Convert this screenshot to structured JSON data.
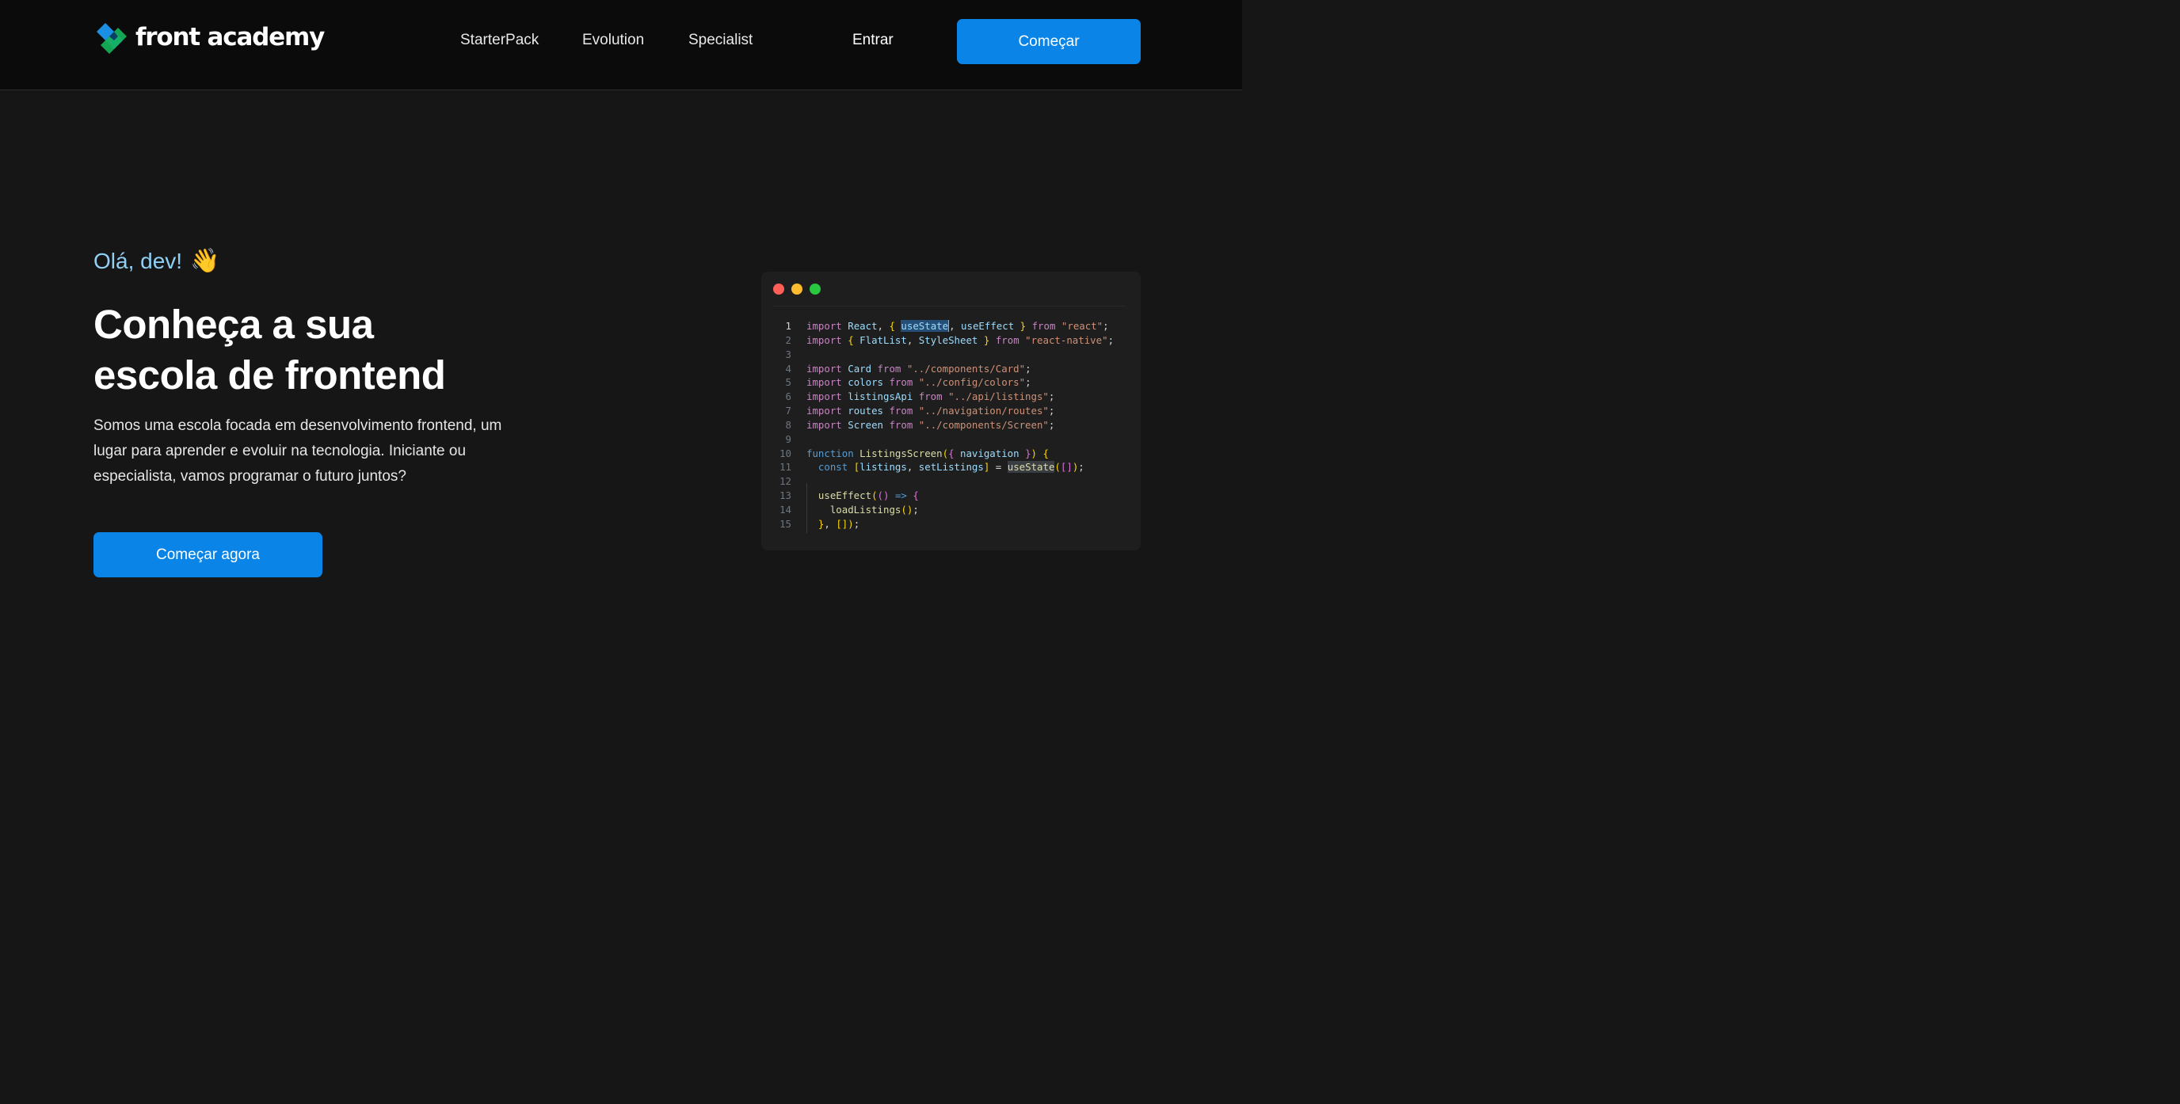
{
  "header": {
    "brand": "front academy",
    "nav": [
      "StarterPack",
      "Evolution",
      "Specialist"
    ],
    "login_label": "Entrar",
    "cta_label": "Começar"
  },
  "hero": {
    "greeting": "Olá, dev!",
    "greeting_emoji": "👋",
    "headline_line1": "Conheça a sua",
    "headline_line2": "escola de frontend",
    "description": "Somos uma escola focada em desenvolvimento frontend, um lugar para aprender e evoluir na tecnologia. Iniciante ou especialista, vamos programar o futuro juntos?",
    "cta_label": "Começar agora"
  },
  "code_window": {
    "window_controls": [
      "close",
      "minimize",
      "maximize"
    ],
    "lines": [
      {
        "n": "1",
        "text": "import React, { useState, useEffect } from \"react\";"
      },
      {
        "n": "2",
        "text": "import { FlatList, StyleSheet } from \"react-native\";"
      },
      {
        "n": "3",
        "text": ""
      },
      {
        "n": "4",
        "text": "import Card from \"../components/Card\";"
      },
      {
        "n": "5",
        "text": "import colors from \"../config/colors\";"
      },
      {
        "n": "6",
        "text": "import listingsApi from \"../api/listings\";"
      },
      {
        "n": "7",
        "text": "import routes from \"../navigation/routes\";"
      },
      {
        "n": "8",
        "text": "import Screen from \"../components/Screen\";"
      },
      {
        "n": "9",
        "text": ""
      },
      {
        "n": "10",
        "text": "function ListingsScreen({ navigation }) {"
      },
      {
        "n": "11",
        "text": "  const [listings, setListings] = useState([]);"
      },
      {
        "n": "12",
        "text": ""
      },
      {
        "n": "13",
        "text": "  useEffect(() => {"
      },
      {
        "n": "14",
        "text": "    loadListings();"
      },
      {
        "n": "15",
        "text": "  }, []);"
      }
    ]
  },
  "colors": {
    "accent": "#0a84e6",
    "greeting": "#8fd0f4",
    "background": "#161616",
    "header_bg": "#0b0b0b"
  }
}
